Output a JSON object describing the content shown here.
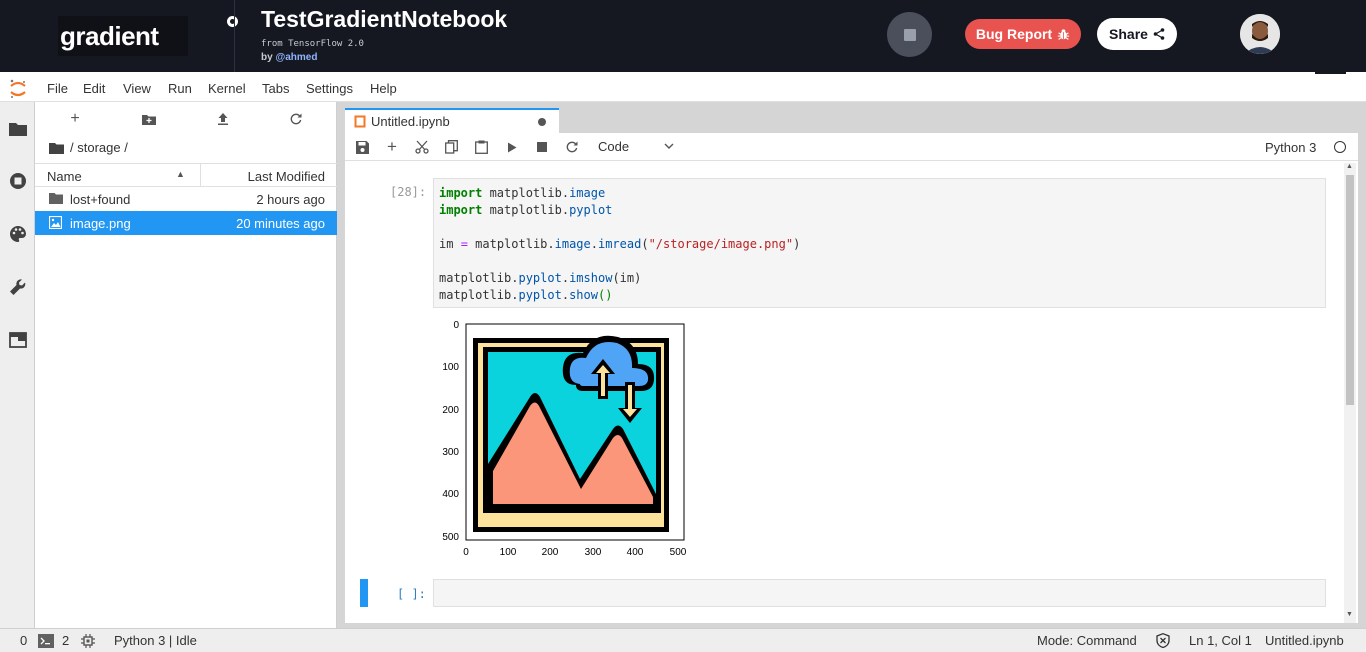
{
  "header": {
    "logo_text": "gradient",
    "notebook_title": "TestGradientNotebook",
    "from_text": "from TensorFlow 2.0",
    "by_prefix": "by",
    "by_user": "@ahmed",
    "bug_report_label": "Bug Report",
    "share_label": "Share"
  },
  "menu": [
    "File",
    "Edit",
    "View",
    "Run",
    "Kernel",
    "Tabs",
    "Settings",
    "Help"
  ],
  "file_browser": {
    "breadcrumb": "/ storage /",
    "col_name": "Name",
    "col_modified": "Last Modified",
    "files": [
      {
        "name": "lost+found",
        "modified": "2 hours ago",
        "type": "folder"
      },
      {
        "name": "image.png",
        "modified": "20 minutes ago",
        "type": "image"
      }
    ]
  },
  "notebook": {
    "tab_title": "Untitled.ipynb",
    "cell_type": "Code",
    "kernel_name": "Python 3",
    "cell1_prompt": "[28]:",
    "cell2_prompt": "[ ]:",
    "code": {
      "l1_kw": "import",
      "l1_rest": " matplotlib.",
      "l1_attr": "image",
      "l2_kw": "import",
      "l2_rest": " matplotlib.",
      "l2_attr": "pyplot",
      "l3_a": "im ",
      "l3_op": "=",
      "l3_b": " matplotlib.",
      "l3_attr1": "image",
      "l3_dot": ".",
      "l3_attr2": "imread",
      "l3_p1": "(",
      "l3_str": "\"/storage/image.png\"",
      "l3_p2": ")",
      "l4_a": "matplotlib.",
      "l4_attr1": "pyplot",
      "l4_dot": ".",
      "l4_attr2": "imshow",
      "l4_rest": "(im)",
      "l5_a": "matplotlib.",
      "l5_attr1": "pyplot",
      "l5_dot": ".",
      "l5_attr2": "show",
      "l5_rest": "()"
    },
    "plot": {
      "y_ticks": [
        "0",
        "100",
        "200",
        "300",
        "400",
        "500"
      ],
      "x_ticks": [
        "0",
        "100",
        "200",
        "300",
        "400",
        "500"
      ]
    }
  },
  "status": {
    "terminals": "0",
    "kernels": "2",
    "kernel_state": "Python 3 | Idle",
    "mode": "Mode: Command",
    "cursor": "Ln 1, Col 1",
    "file": "Untitled.ipynb"
  },
  "colors": {
    "accent": "#2196f3",
    "topbar": "#151821",
    "bug_button": "#e9534f"
  }
}
